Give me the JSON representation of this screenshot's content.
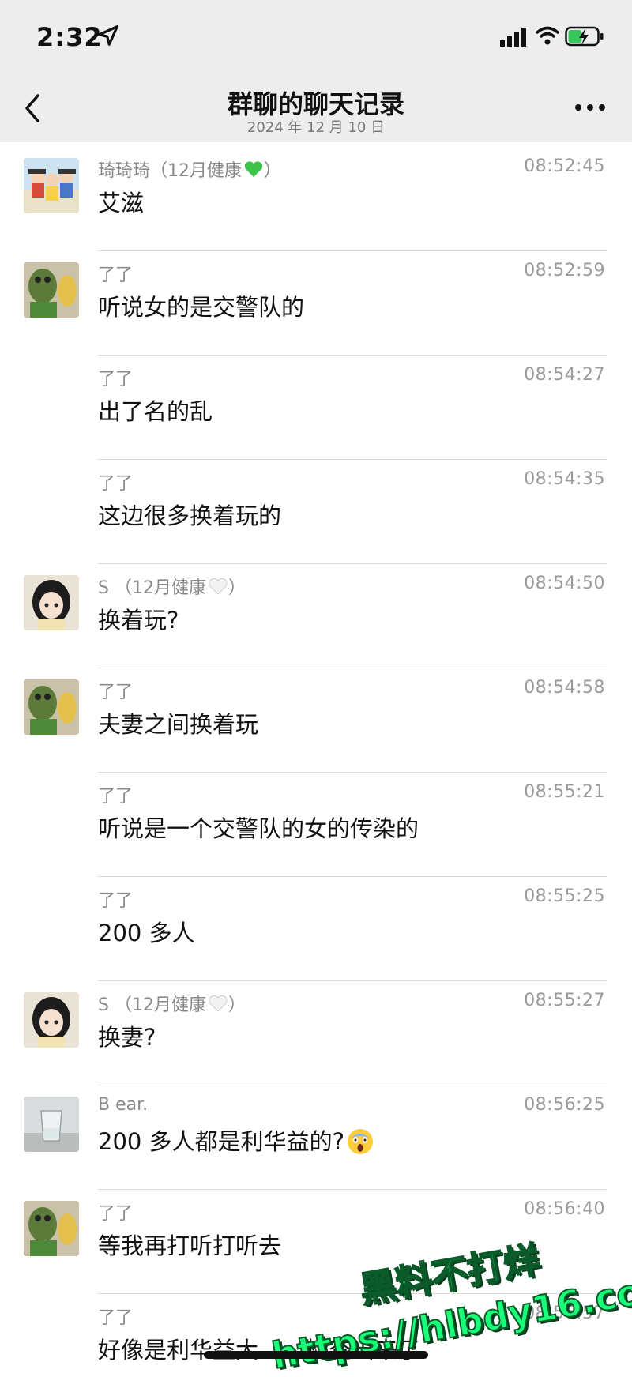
{
  "status_bar": {
    "time": "2:32",
    "icons": [
      "location-arrow-icon",
      "signal-icon",
      "wifi-icon",
      "battery-charging-icon"
    ]
  },
  "header": {
    "title": "群聊的聊天记录",
    "subtitle": "2024 年 12 月 10 日",
    "back_icon": "chevron-left-icon",
    "more_icon": "more-dots-icon"
  },
  "messages": [
    {
      "sender": "琦琦琦（12月健康",
      "sender_suffix": "）",
      "heart": "green",
      "time": "08:52:45",
      "text": "艾滋",
      "avatar": "cartoon-group"
    },
    {
      "sender": "了了",
      "time": "08:52:59",
      "text": "听说女的是交警队的",
      "avatar": "green-plush"
    },
    {
      "sender": "了了",
      "time": "08:54:27",
      "text": "出了名的乱",
      "avatar": null
    },
    {
      "sender": "了了",
      "time": "08:54:35",
      "text": "这边很多换着玩的",
      "avatar": null
    },
    {
      "sender": "S （12月健康",
      "sender_suffix": "）",
      "heart": "white",
      "time": "08:54:50",
      "text": "换着玩?",
      "avatar": "anime-girl"
    },
    {
      "sender": "了了",
      "time": "08:54:58",
      "text": "夫妻之间换着玩",
      "avatar": "green-plush"
    },
    {
      "sender": "了了",
      "time": "08:55:21",
      "text": "听说是一个交警队的女的传染的",
      "avatar": null
    },
    {
      "sender": "了了",
      "time": "08:55:25",
      "text": "200 多人",
      "avatar": null
    },
    {
      "sender": "S （12月健康",
      "sender_suffix": "）",
      "heart": "white",
      "time": "08:55:27",
      "text": "换妻?",
      "avatar": "anime-girl"
    },
    {
      "sender": "B ear.",
      "time": "08:56:25",
      "text": "200 多人都是利华益的?",
      "emoji": "scream",
      "avatar": "glass-photo"
    },
    {
      "sender": "了了",
      "time": "08:56:40",
      "text": "等我再打听打听去",
      "avatar": "green-plush"
    },
    {
      "sender": "了了",
      "time": "08:56:57",
      "text": "好像是利华益大",
      "text_tail": "检查出来了",
      "avatar": null
    }
  ],
  "watermark": {
    "line1": "黑料不打烊",
    "line2": "https://hlbdy16.com"
  },
  "colors": {
    "topbar_bg": "#ededed",
    "divider": "#dcdcdc",
    "name_gray": "#8a8a8a",
    "watermark_green": "#19ff7a"
  }
}
